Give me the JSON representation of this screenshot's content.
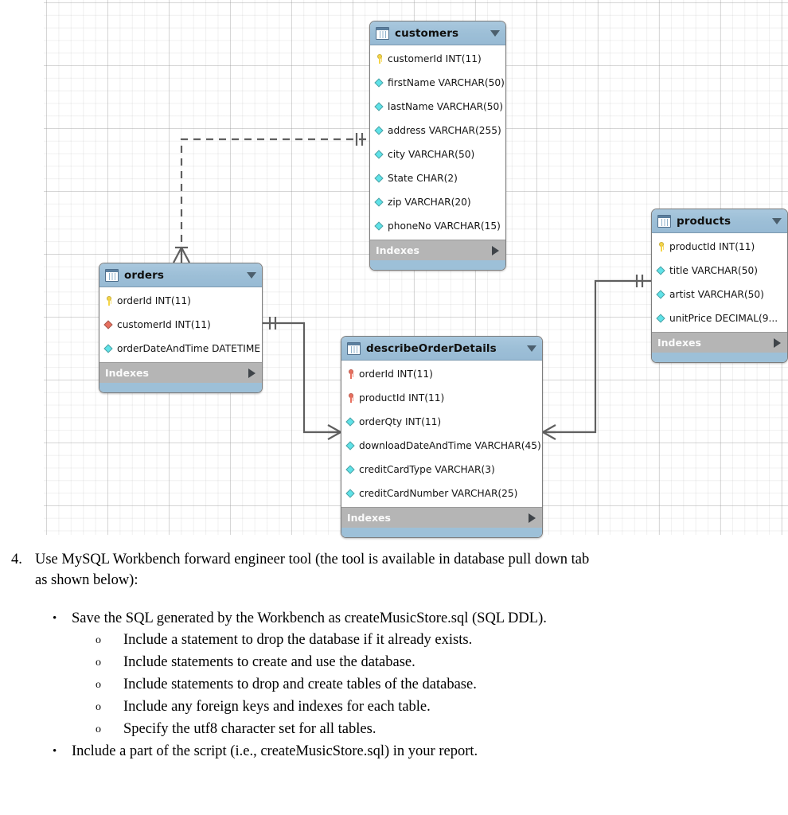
{
  "diagram": {
    "name": "eer-diagram-canvas",
    "tables": [
      {
        "name": "customers",
        "indexes_label": "Indexes",
        "columns": [
          {
            "icon": "primary-key-icon",
            "text": "customerId INT(11)"
          },
          {
            "icon": "column-diamond-icon",
            "text": "firstName VARCHAR(50)"
          },
          {
            "icon": "column-diamond-icon",
            "text": "lastName VARCHAR(50)"
          },
          {
            "icon": "column-diamond-icon",
            "text": "address VARCHAR(255)"
          },
          {
            "icon": "column-diamond-icon",
            "text": "city VARCHAR(50)"
          },
          {
            "icon": "column-diamond-icon",
            "text": "State CHAR(2)"
          },
          {
            "icon": "column-diamond-icon",
            "text": "zip VARCHAR(20)"
          },
          {
            "icon": "column-diamond-icon",
            "text": "phoneNo VARCHAR(15)"
          }
        ]
      },
      {
        "name": "orders",
        "indexes_label": "Indexes",
        "columns": [
          {
            "icon": "primary-key-icon",
            "text": "orderId INT(11)"
          },
          {
            "icon": "foreign-key-diamond-icon",
            "text": "customerId INT(11)"
          },
          {
            "icon": "column-diamond-icon",
            "text": "orderDateAndTime DATETIME"
          }
        ]
      },
      {
        "name": "describeOrderDetails",
        "indexes_label": "Indexes",
        "columns": [
          {
            "icon": "primary-foreign-key-icon",
            "text": "orderId INT(11)"
          },
          {
            "icon": "primary-foreign-key-icon",
            "text": "productId INT(11)"
          },
          {
            "icon": "column-diamond-icon",
            "text": "orderQty INT(11)"
          },
          {
            "icon": "column-diamond-icon",
            "text": "downloadDateAndTime VARCHAR(45)"
          },
          {
            "icon": "column-diamond-icon",
            "text": "creditCardType VARCHAR(3)"
          },
          {
            "icon": "column-diamond-icon",
            "text": "creditCardNumber VARCHAR(25)"
          }
        ]
      },
      {
        "name": "products",
        "indexes_label": "Indexes",
        "columns": [
          {
            "icon": "primary-key-icon",
            "text": "productId INT(11)"
          },
          {
            "icon": "column-diamond-icon",
            "text": "title VARCHAR(50)"
          },
          {
            "icon": "column-diamond-icon",
            "text": "artist VARCHAR(50)"
          },
          {
            "icon": "column-diamond-icon",
            "text": "unitPrice DECIMAL(9..."
          }
        ]
      }
    ],
    "colors": {
      "header_blue": "#9dbfd7",
      "indexes_gray": "#b5b5b5",
      "primary_key_yellow": "#f5d547",
      "foreign_key_red": "#e8705f",
      "column_cyan": "#5fe2e8",
      "connector_gray": "#5f5f5f"
    }
  },
  "document": {
    "item_number": "4.",
    "item_text": "Use MySQL Workbench forward engineer tool (the tool is available in database pull down tab as shown below):",
    "bullet_char": "•",
    "circle_char": "o",
    "bullets": [
      {
        "text": "Save the SQL generated by the Workbench as createMusicStore.sql (SQL DDL).",
        "sub": [
          "Include a statement to drop the database if it already exists.",
          "Include statements to create and use the database.",
          "Include statements to drop and create tables of the database.",
          "Include any foreign keys and indexes for each table.",
          "Specify the utf8 character set for all tables."
        ]
      },
      {
        "text": "Include a part of the script (i.e., createMusicStore.sql) in your report.",
        "sub": []
      }
    ]
  }
}
